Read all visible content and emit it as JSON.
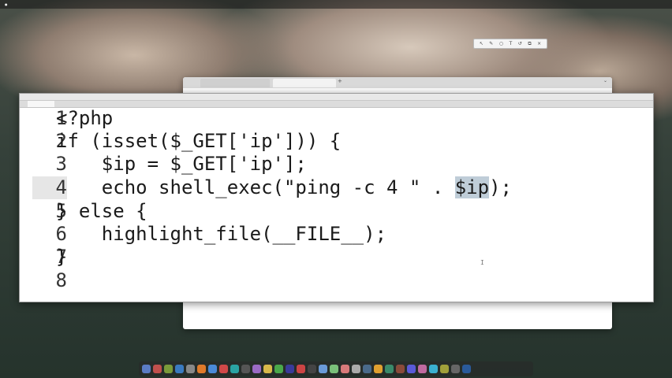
{
  "editor": {
    "lines": [
      {
        "n": "1",
        "text": "<?php"
      },
      {
        "n": "2",
        "text": "if (isset($_GET['ip'])) {"
      },
      {
        "n": "3",
        "text": "    $ip = $_GET['ip'];"
      },
      {
        "n": "4",
        "text_before": "    echo shell_exec(\"ping -c 4 \" . ",
        "highlight": "$ip",
        "text_after": ");"
      },
      {
        "n": "5",
        "text": "} else {"
      },
      {
        "n": "6",
        "text": "    highlight_file(__FILE__);"
      },
      {
        "n": "7",
        "text": "}"
      },
      {
        "n": "8",
        "text": ""
      }
    ]
  },
  "dock": {
    "icon_colors": [
      "#5b7cc4",
      "#c0504d",
      "#7a9a3a",
      "#3a7ac0",
      "#888888",
      "#e07a2a",
      "#4a8ad8",
      "#d04848",
      "#2aa3a3",
      "#555555",
      "#9a6ac4",
      "#d8b84a",
      "#4aa84a",
      "#3a3a9a",
      "#cc4444",
      "#444444",
      "#6a9ad8",
      "#7ac07a",
      "#d87a7a",
      "#aaaaaa",
      "#4a6a8a",
      "#e0a030",
      "#3a8a6a",
      "#8a4a3a",
      "#5a5ad8",
      "#c06aa0",
      "#3ab0d0",
      "#a0a03a",
      "#666666",
      "#2a5a9a"
    ]
  }
}
